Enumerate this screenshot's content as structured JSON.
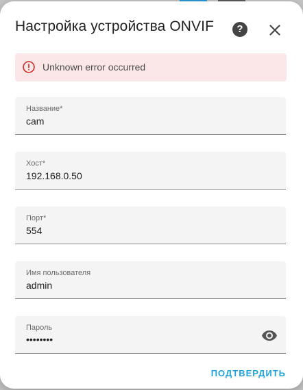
{
  "dialog": {
    "title": "Настройка устройства ONVIF",
    "help_icon": "help-circle-icon",
    "close_icon": "close-icon"
  },
  "error": {
    "icon": "alert-circle-icon",
    "message": "Unknown error occurred",
    "color": "#d32f2f",
    "background": "#fbe7e7"
  },
  "form": {
    "fields": [
      {
        "label": "Название*",
        "value": "cam"
      },
      {
        "label": "Хост*",
        "value": "192.168.0.50"
      },
      {
        "label": "Порт*",
        "value": "554"
      },
      {
        "label": "Имя пользователя",
        "value": "admin"
      },
      {
        "label": "Пароль",
        "value": "••••••••",
        "icon": "eye-icon"
      }
    ]
  },
  "actions": {
    "submit_label": "ПОДТВЕРДИТЬ",
    "accent": "#1ea3dc"
  }
}
